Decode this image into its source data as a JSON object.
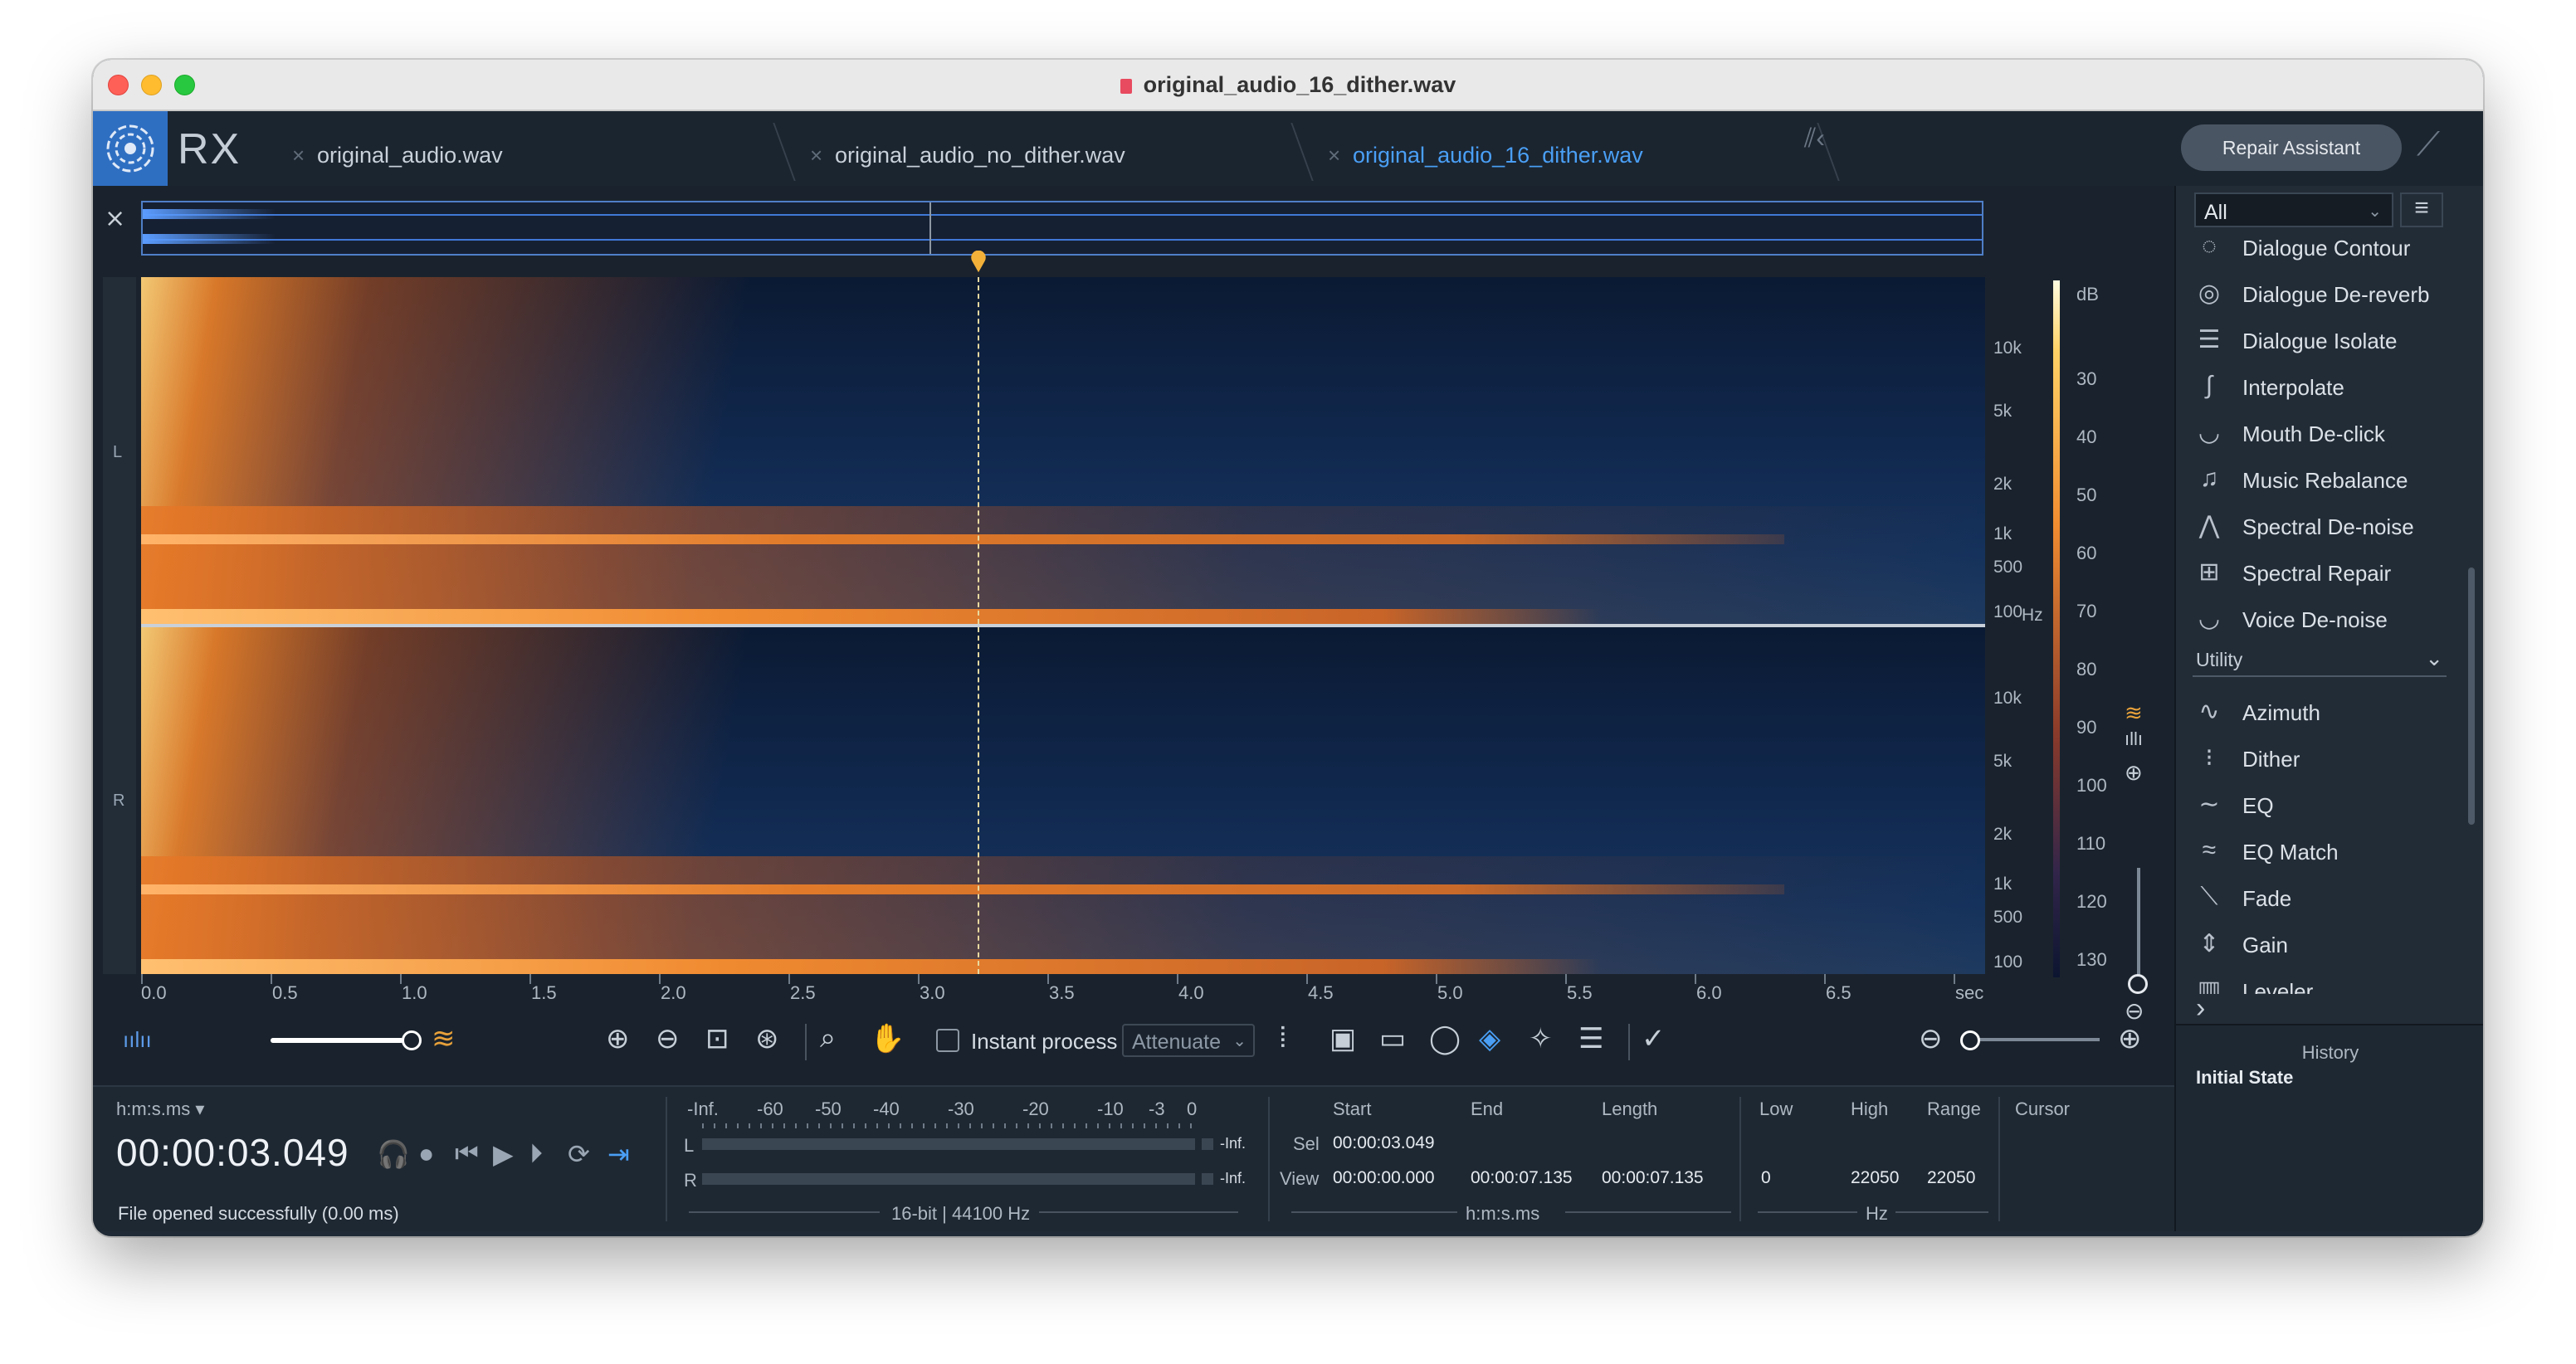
{
  "window": {
    "title": "original_audio_16_dither.wav"
  },
  "app": {
    "name": "RX"
  },
  "tabs": [
    {
      "label": "original_audio.wav",
      "active": false
    },
    {
      "label": "original_audio_no_dither.wav",
      "active": false
    },
    {
      "label": "original_audio_16_dither.wav",
      "active": true
    }
  ],
  "repair_assistant_label": "Repair Assistant",
  "channels": {
    "left": "L",
    "right": "R"
  },
  "freq_axis": {
    "left": [
      "10k",
      "5k",
      "2k",
      "1k",
      "500",
      "100"
    ],
    "right": [
      "10k",
      "5k",
      "2k",
      "1k",
      "500",
      "100"
    ],
    "unit": "Hz"
  },
  "db_axis": {
    "unit": "dB",
    "ticks": [
      "30",
      "40",
      "50",
      "60",
      "70",
      "80",
      "90",
      "100",
      "110",
      "120",
      "130"
    ]
  },
  "time_axis": {
    "ticks": [
      "0.0",
      "0.5",
      "1.0",
      "1.5",
      "2.0",
      "2.5",
      "3.0",
      "3.5",
      "4.0",
      "4.5",
      "5.0",
      "5.5",
      "6.0",
      "6.5"
    ],
    "unit": "sec"
  },
  "toolbar": {
    "instant_process_label": "Instant process",
    "instant_process_checked": false,
    "mode_value": "Attenuate"
  },
  "transport": {
    "time_format": "h:m:s.ms",
    "timecode": "00:00:03.049",
    "status": "File opened successfully (0.00 ms)"
  },
  "meter": {
    "scale": [
      "-Inf.",
      "-60",
      "-50",
      "-40",
      "-30",
      "-20",
      "-10",
      "-3",
      "0"
    ],
    "left_label": "L",
    "right_label": "R",
    "left_value": "-Inf.",
    "right_value": "-Inf.",
    "format": "16-bit | 44100 Hz"
  },
  "selection": {
    "headers": [
      "Start",
      "End",
      "Length"
    ],
    "sel_label": "Sel",
    "sel_start": "00:00:03.049",
    "view_label": "View",
    "view_start": "00:00:00.000",
    "view_end": "00:00:07.135",
    "view_length": "00:00:07.135",
    "unit": "h:m:s.ms"
  },
  "frequency": {
    "headers": [
      "Low",
      "High",
      "Range"
    ],
    "low": "0",
    "high": "22050",
    "range": "22050",
    "unit": "Hz"
  },
  "cursor_label": "Cursor",
  "panel": {
    "filter_value": "All",
    "modules_top": [
      {
        "label": "Dialogue Contour",
        "icon": "dialogue-contour-icon"
      },
      {
        "label": "Dialogue De-reverb",
        "icon": "dialogue-dereverb-icon"
      },
      {
        "label": "Dialogue Isolate",
        "icon": "dialogue-isolate-icon"
      },
      {
        "label": "Interpolate",
        "icon": "interpolate-icon"
      },
      {
        "label": "Mouth De-click",
        "icon": "mouth-declick-icon"
      },
      {
        "label": "Music Rebalance",
        "icon": "music-rebalance-icon"
      },
      {
        "label": "Spectral De-noise",
        "icon": "spectral-denoise-icon"
      },
      {
        "label": "Spectral Repair",
        "icon": "spectral-repair-icon"
      },
      {
        "label": "Voice De-noise",
        "icon": "voice-denoise-icon"
      }
    ],
    "section_label": "Utility",
    "modules_utility": [
      {
        "label": "Azimuth",
        "icon": "azimuth-icon"
      },
      {
        "label": "Dither",
        "icon": "dither-icon"
      },
      {
        "label": "EQ",
        "icon": "eq-icon"
      },
      {
        "label": "EQ Match",
        "icon": "eq-match-icon"
      },
      {
        "label": "Fade",
        "icon": "fade-icon"
      },
      {
        "label": "Gain",
        "icon": "gain-icon"
      },
      {
        "label": "Leveler",
        "icon": "leveler-icon"
      }
    ],
    "history_title": "History",
    "history_items": [
      "Initial State"
    ]
  },
  "colors": {
    "accent": "#4a9ff5",
    "logo_bg": "#2f6fc2",
    "window_bg": "#1f2a36"
  }
}
